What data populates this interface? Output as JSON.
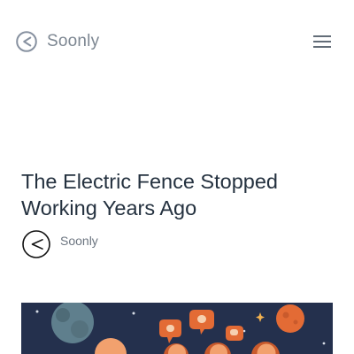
{
  "header": {
    "brand_name": "Soonly",
    "logo_icon": "soonly-logo-icon",
    "menu_icon": "hamburger-menu-icon"
  },
  "article": {
    "title": "The Electric Fence Stopped Working Years Ago",
    "author": {
      "name": "Soonly",
      "avatar_icon": "soonly-avatar-icon"
    },
    "hero_image": {
      "icon": "space-chat-illustration",
      "colors": {
        "background": "#24304d",
        "planet": "#5f7f8d",
        "orange": "#e36b35",
        "peach": "#f2a16e"
      }
    }
  },
  "colors": {
    "brand_text": "#7d8792",
    "title_text": "#24313f",
    "author_text": "#6c7580"
  }
}
